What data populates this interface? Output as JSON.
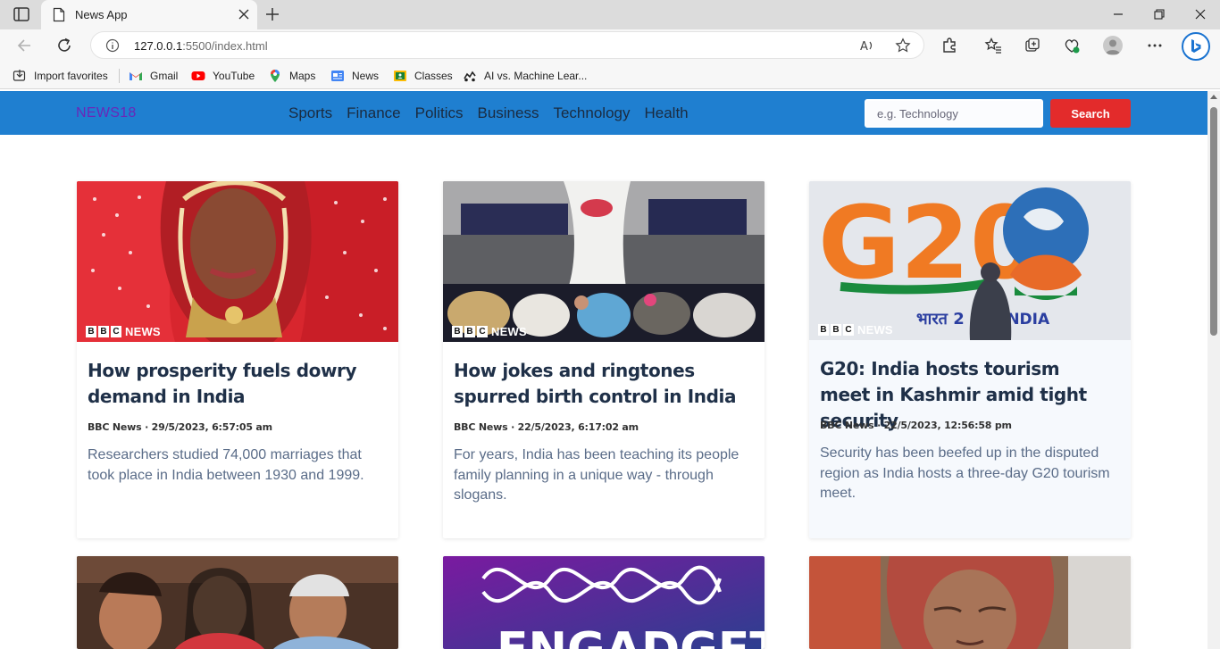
{
  "browser": {
    "tab_title": "News App",
    "url_host": "127.0.0.1",
    "url_rest": ":5500/index.html",
    "favorites": [
      {
        "label": "Import favorites",
        "icon": "import-icon"
      },
      {
        "label": "Gmail",
        "icon": "gmail-icon"
      },
      {
        "label": "YouTube",
        "icon": "youtube-icon"
      },
      {
        "label": "Maps",
        "icon": "maps-icon"
      },
      {
        "label": "News",
        "icon": "news-icon"
      },
      {
        "label": "Classes",
        "icon": "classes-icon"
      },
      {
        "label": "AI vs. Machine Lear...",
        "icon": "bookmark-icon"
      }
    ]
  },
  "navbar": {
    "brand": "NEWS18",
    "links": [
      "Sports",
      "Finance",
      "Politics",
      "Business",
      "Technology",
      "Health"
    ],
    "search_placeholder": "e.g. Technology",
    "search_button": "Search"
  },
  "articles": [
    {
      "title": "How prosperity fuels dowry demand in India",
      "meta": "BBC News · 29/5/2023, 6:57:05 am",
      "description": "Researchers studied 74,000 marriages that took place in India between 1930 and 1999.",
      "image_logo": "NEWS"
    },
    {
      "title": "How jokes and ringtones spurred birth control in India",
      "meta": "BBC News · 22/5/2023, 6:17:02 am",
      "description": "For years, India has been teaching its people family planning in a unique way - through slogans.",
      "image_logo": "NEWS"
    },
    {
      "title": "G20: India hosts tourism meet in Kashmir amid tight security",
      "meta": "BBC News · 22/5/2023, 12:56:58 pm",
      "description": "Security has been beefed up in the disputed region as India hosts a three-day G20 tourism meet.",
      "image_logo": "NEWS",
      "image_text_g20": "G20",
      "image_text_bharat": "भारत 2",
      "image_text_india": "INDIA"
    }
  ],
  "partial_cards": {
    "engadget_text": "ENGADGET"
  },
  "colors": {
    "navbar": "#1f7fd0",
    "brand": "#6a27b8",
    "search_button": "#e32b2b",
    "title": "#1f3048",
    "description": "#5a6c88"
  }
}
